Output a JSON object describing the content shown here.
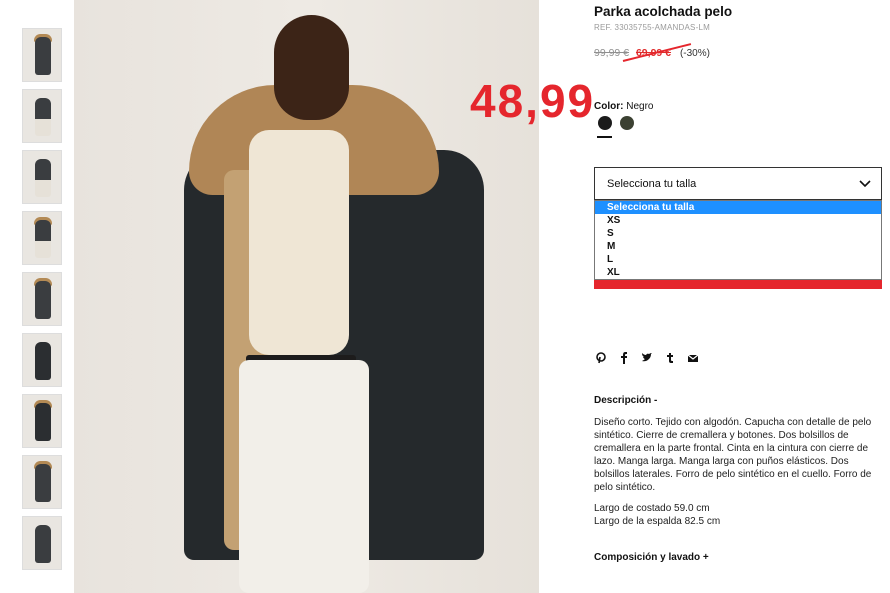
{
  "product": {
    "title": "Parka acolchada pelo",
    "ref": "REF. 33035755-AMANDAS-LM",
    "price_old": "99,99 €",
    "price_sale": "69,99 €",
    "discount": "(-30%)",
    "overlay_price": "48,99"
  },
  "color": {
    "label": "Color:",
    "value": "Negro",
    "swatches": [
      "#1b1b1b",
      "#3c4132"
    ]
  },
  "size": {
    "placeholder": "Selecciona tu talla",
    "options": [
      "Selecciona tu talla",
      "XS",
      "S",
      "M",
      "L",
      "XL"
    ],
    "selected_index": 0
  },
  "social_icons": [
    "pinterest-icon",
    "facebook-icon",
    "twitter-icon",
    "tumblr-icon",
    "email-icon"
  ],
  "description": {
    "title": "Descripción -",
    "text": "Diseño corto. Tejido con algodón. Capucha con detalle de pelo sintético. Cierre de cremallera y botones. Dos bolsillos de cremallera en la parte frontal. Cinta en la cintura con cierre de lazo. Manga larga. Manga larga con puños elásticos. Dos bolsillos laterales. Forro de pelo sintético en el cuello. Forro de pelo sintético.",
    "length_front": "Largo de costado 59.0 cm",
    "length_back": "Largo de la espalda 82.5 cm"
  },
  "composition": {
    "label": "Composición y lavado +"
  },
  "colors": {
    "accent_red": "#e5262d",
    "selected_blue": "#1e90ff"
  }
}
